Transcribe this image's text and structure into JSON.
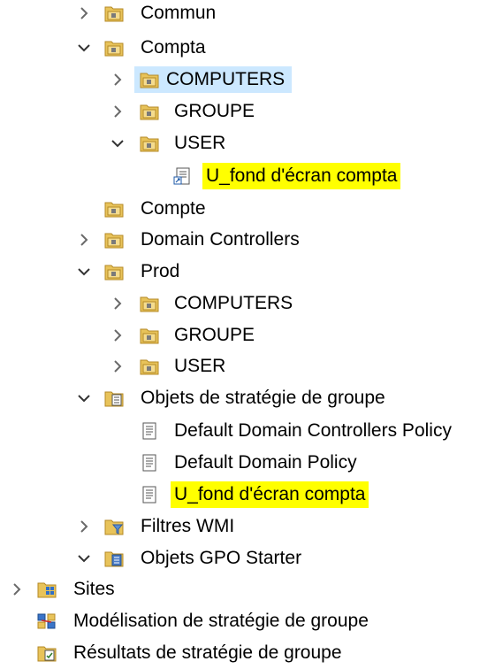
{
  "colors": {
    "highlight": "#ffff00",
    "selection": "#cce8ff",
    "folder": "#e8c35a",
    "chevron": "#6a6a6a"
  },
  "tree": {
    "commun": "Commun",
    "compta": "Compta",
    "compta_computers": "COMPUTERS",
    "compta_groupe": "GROUPE",
    "compta_user": "USER",
    "compta_user_link": "U_fond d'écran compta",
    "compte": "Compte",
    "domain_controllers": "Domain Controllers",
    "prod": "Prod",
    "prod_computers": "COMPUTERS",
    "prod_groupe": "GROUPE",
    "prod_user": "USER",
    "gpo_container": "Objets de stratégie de groupe",
    "gpo_1": "Default Domain Controllers Policy",
    "gpo_2": "Default Domain Policy",
    "gpo_3": "U_fond d'écran compta",
    "wmi_filters": "Filtres WMI",
    "starter_gpos": "Objets GPO Starter",
    "sites": "Sites",
    "modeling": "Modélisation de stratégie de groupe",
    "results": "Résultats de stratégie de groupe"
  }
}
